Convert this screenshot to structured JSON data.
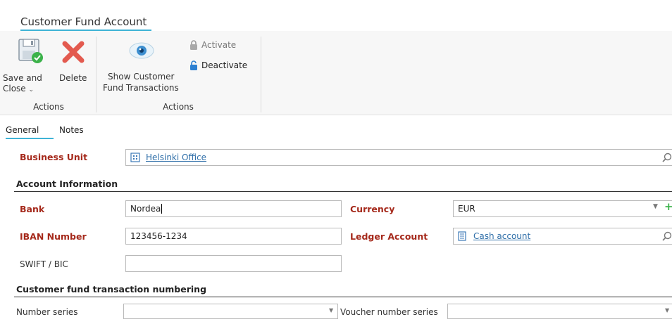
{
  "title": "Customer Fund Account",
  "ribbon": {
    "save_close_line1": "Save and",
    "save_close_line2": "Close",
    "delete_label": "Delete",
    "show_txn_line1": "Show Customer",
    "show_txn_line2": "Fund Transactions",
    "activate_label": "Activate",
    "deactivate_label": "Deactivate",
    "group1_label": "Actions",
    "group2_label": "Actions"
  },
  "tabs": {
    "general": "General",
    "notes": "Notes"
  },
  "form": {
    "business_unit_label": "Business Unit",
    "business_unit_value": "Helsinki Office",
    "account_info_section": "Account Information",
    "bank_label": "Bank",
    "bank_value": "Nordea",
    "currency_label": "Currency",
    "currency_value": "EUR",
    "iban_label": "IBAN Number",
    "iban_value": "123456-1234",
    "ledger_label": "Ledger Account",
    "ledger_value": "Cash account",
    "swift_label": "SWIFT / BIC",
    "swift_value": "",
    "numbering_section": "Customer fund transaction numbering",
    "number_series_label": "Number series",
    "number_series_value": "",
    "voucher_series_label": "Voucher number series",
    "voucher_series_value": ""
  },
  "colors": {
    "accent": "#3fb3d6",
    "required_label": "#a5291b",
    "link": "#2e6ea8",
    "delete_red": "#e35a4f"
  }
}
